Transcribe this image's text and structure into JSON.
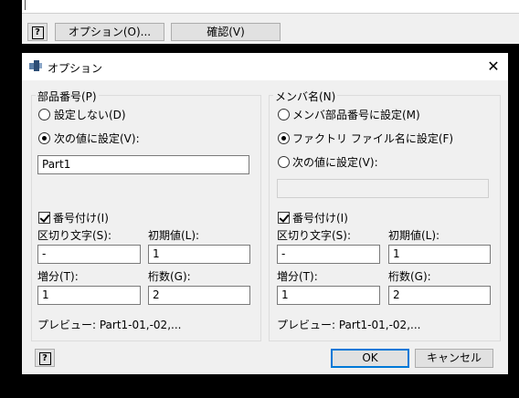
{
  "background": {
    "options_button_label": "オプション(O)...",
    "confirm_button_label": "確認(V)"
  },
  "dialog": {
    "title": "オプション",
    "part_number_group": {
      "label": "部品番号(P)",
      "radio_no_set": "設定しない(D)",
      "radio_set_value": "次の値に設定(V):",
      "value": "Part1",
      "numbering_label": "番号付け(I)",
      "separator_label": "区切り文字(S):",
      "separator_value": "-",
      "initial_label": "初期値(L):",
      "initial_value": "1",
      "increment_label": "増分(T):",
      "increment_value": "1",
      "digits_label": "桁数(G):",
      "digits_value": "2",
      "preview": "プレビュー:  Part1-01,-02,..."
    },
    "member_name_group": {
      "label": "メンバ名(N)",
      "radio_member_part": "メンバ部品番号に設定(M)",
      "radio_factory_file": "ファクトリ ファイル名に設定(F)",
      "radio_set_value": "次の値に設定(V):",
      "value": "",
      "numbering_label": "番号付け(I)",
      "separator_label": "区切り文字(S):",
      "separator_value": "-",
      "initial_label": "初期値(L):",
      "initial_value": "1",
      "increment_label": "増分(T):",
      "increment_value": "1",
      "digits_label": "桁数(G):",
      "digits_value": "2",
      "preview": "プレビュー:  Part1-01,-02,..."
    },
    "ok_label": "OK",
    "cancel_label": "キャンセル"
  }
}
